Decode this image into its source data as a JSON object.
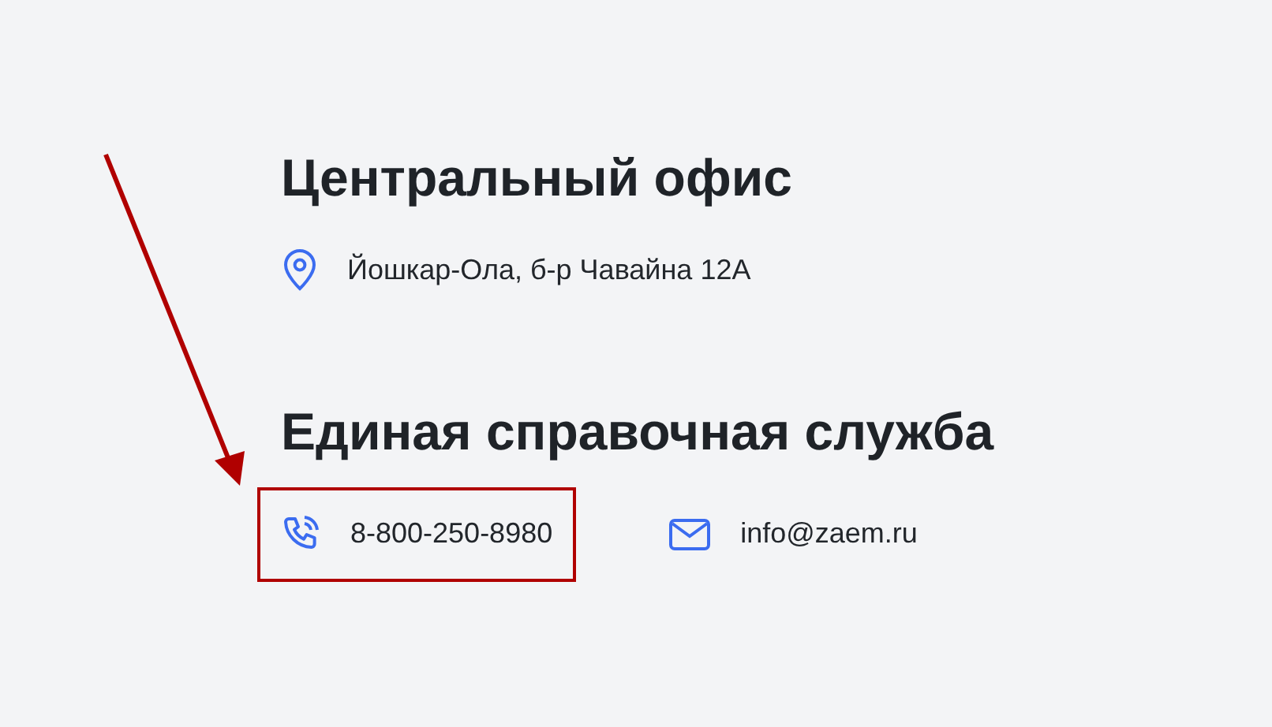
{
  "offices": [
    {
      "title": "Центральный офис",
      "contacts": [
        {
          "kind": "address",
          "text": "Йошкар-Ола, б-р Чавайна 12А",
          "highlighted": false
        }
      ]
    },
    {
      "title": "Единая справочная служба",
      "contacts": [
        {
          "kind": "phone",
          "text": "8-800-250-8980",
          "highlighted": true
        },
        {
          "kind": "email",
          "text": "info@zaem.ru",
          "highlighted": false
        }
      ]
    }
  ]
}
